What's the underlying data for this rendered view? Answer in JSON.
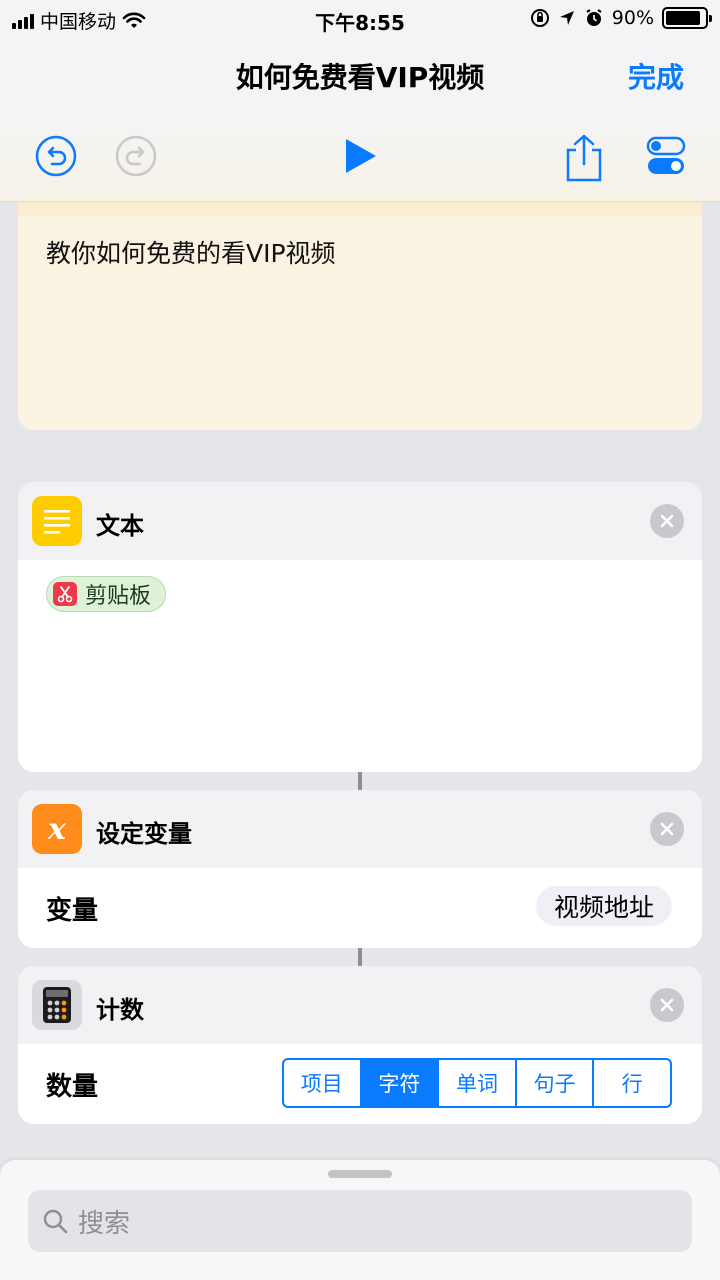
{
  "status": {
    "carrier": "中国移动",
    "time": "下午8:55",
    "battery_percent": "90%",
    "battery_level": 0.9
  },
  "nav": {
    "title": "如何免费看VIP视频",
    "done_label": "完成"
  },
  "toolbar": {
    "icons": [
      "undo-icon",
      "redo-icon",
      "play-icon",
      "share-icon",
      "settings-toggle-icon"
    ]
  },
  "comment": {
    "text": "教你如何免费的看VIP视频"
  },
  "text_action": {
    "title": "文本",
    "token_label": "剪贴板"
  },
  "set_variable_action": {
    "title": "设定变量",
    "row_label": "变量",
    "value": "视频地址"
  },
  "count_action": {
    "title": "计数",
    "row_label": "数量",
    "options": [
      "项目",
      "字符",
      "单词",
      "句子",
      "行"
    ],
    "selected": "字符"
  },
  "search": {
    "placeholder": "搜索"
  },
  "colors": {
    "accent": "#0a7aff",
    "text_icon": "#ffcc00",
    "variable_icon": "#ff8c1a",
    "clipboard_icon": "#f0384a"
  }
}
